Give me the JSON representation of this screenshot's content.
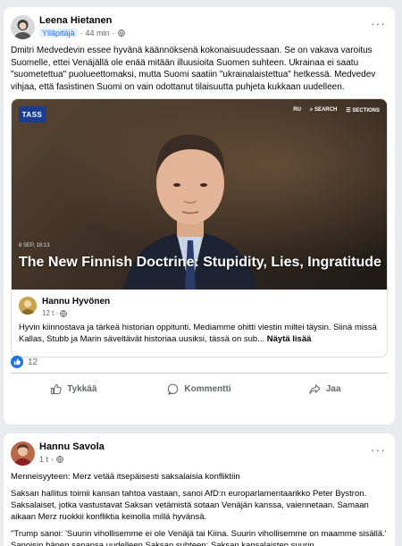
{
  "post1": {
    "author": "Leena Hietanen",
    "role": "Ylläpitäjä",
    "time": "44 min",
    "separator": "·",
    "more_label": "···",
    "text": "Dmitri Medvedevin essee hyvänä käännöksenä kokonaisuudessaan. Se on vakava varoitus Suomelle, ettei Venäjällä ole enää mitään illuusioita Suomen suhteen. Ukrainaa ei saatu \"suometettua\" puolueettomaksi,  mutta Suomi saatiin \"ukrainalaistettua\" hetkessä.  Medvedev vihjaa, että fasistinen Suomi on vain odottanut tilaisuutta puhjeta kukkaan uudelleen.",
    "shared": {
      "media": {
        "logo": "TASS",
        "nav_ru": "RU",
        "nav_search": "SEARCH",
        "nav_sections": "SECTIONS",
        "date": "6 SEP, 18:13",
        "headline": "The New Finnish Doctrine: Stupidity, Lies, Ingratitude"
      },
      "author": "Hannu Hyvönen",
      "time": "12 t",
      "separator": "·",
      "text": "Hyvin kiinnostava ja tärkeä historian oppitunti.  Mediamme ohitti viestin miltei täysin.  Siinä missä Kallas, Stubb ja Marin säveltävät historiaa uusiksi,  tässä on sub...",
      "see_more": "Näytä lisää"
    },
    "reaction_count": "12",
    "actions": {
      "like": "Tykkää",
      "comment": "Kommentti",
      "share": "Jaa"
    }
  },
  "post2": {
    "author": "Hannu Savola",
    "time": "1 t",
    "separator": "·",
    "more_label": "···",
    "paragraphs": [
      "Menneisyyteen: Merz vetää itsepäisesti saksalaisia konfliktiin",
      "Saksan hallitus toimii kansan tahtoa vastaan, sanoi AfD:n europarlamentaarikko Peter Bystron. Saksalaiset, jotka vastustavat Saksan vetämistä sotaan Venäjän kanssa, vaiennetaan. Samaan aikaan Merz ruokkii konfliktia keinolla millä hyvänsä.",
      "\"Trump sanoi: 'Suurin vihollisemme ei ole Venäjä tai Kiina. Suurin vihollisemme on maamme sisällä.' Sanoisin hänen sanansa uudelleen Saksan suhteen: Saksan kansalaisten suurin"
    ]
  },
  "colors": {
    "accent": "#1b74e4",
    "text": "#050505",
    "muted": "#65676b",
    "page_bg": "#e9ebee",
    "tass_blue": "#1a3d8f"
  }
}
